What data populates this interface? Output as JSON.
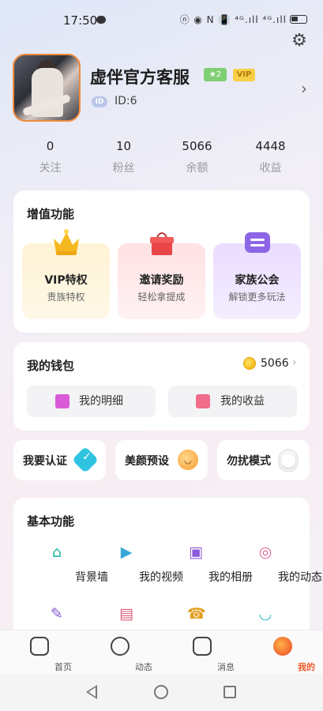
{
  "status_bar": {
    "time": "17:50",
    "icons": "ⓝ ◉ N 📳 ⁴ᴳ.ıll ⁴ᴳ.ıll"
  },
  "profile": {
    "name": "虚伴官方客服",
    "level": "2",
    "vip": "VIP",
    "id_tag": "ID",
    "id_text": "ID:6"
  },
  "stats": [
    {
      "value": "0",
      "label": "关注"
    },
    {
      "value": "10",
      "label": "粉丝"
    },
    {
      "value": "5066",
      "label": "余额"
    },
    {
      "value": "4448",
      "label": "收益"
    }
  ],
  "value_added": {
    "title": "增值功能",
    "items": [
      {
        "title": "VIP特权",
        "subtitle": "贵族特权",
        "icon": "crown-icon"
      },
      {
        "title": "邀请奖励",
        "subtitle": "轻松拿提成",
        "icon": "gift-box-icon"
      },
      {
        "title": "家族公会",
        "subtitle": "解锁更多玩法",
        "icon": "chat-bubble-icon"
      }
    ]
  },
  "wallet": {
    "title": "我的钱包",
    "balance": "5066",
    "buttons": [
      {
        "label": "我的明细",
        "icon": "clipboard-icon"
      },
      {
        "label": "我的收益",
        "icon": "income-icon"
      }
    ]
  },
  "quick_cards": [
    {
      "label": "我要认证",
      "icon": "verify-icon"
    },
    {
      "label": "美颜预设",
      "icon": "smile-icon"
    },
    {
      "label": "勿扰模式",
      "icon": "toggle-icon"
    }
  ],
  "basic": {
    "title": "基本功能",
    "items": [
      {
        "label": "背景墙",
        "icon": "tshirt-icon",
        "glyph": "👕",
        "color": "#22b8a5"
      },
      {
        "label": "我的视频",
        "icon": "video-icon",
        "glyph": "▶",
        "color": "#3aa7d9"
      },
      {
        "label": "我的相册",
        "icon": "album-icon",
        "glyph": "▣",
        "color": "#8b5ad8"
      },
      {
        "label": "我的动态",
        "icon": "planet-icon",
        "glyph": "◎",
        "color": "#e0679a"
      },
      {
        "label": "",
        "icon": "pen-icon",
        "glyph": "✎",
        "color": "#8b5ad8"
      },
      {
        "label": "",
        "icon": "gift-icon",
        "glyph": "▤",
        "color": "#e05d7d"
      },
      {
        "label": "",
        "icon": "phone-icon",
        "glyph": "☎",
        "color": "#e0a020"
      },
      {
        "label": "",
        "icon": "cup-icon",
        "glyph": "◡",
        "color": "#26b9c9"
      }
    ]
  },
  "nav": [
    {
      "label": "首页",
      "icon": "home-icon"
    },
    {
      "label": "动态",
      "icon": "planet-icon"
    },
    {
      "label": "消息",
      "icon": "message-icon"
    },
    {
      "label": "我的",
      "icon": "profile-icon",
      "active": true
    }
  ]
}
